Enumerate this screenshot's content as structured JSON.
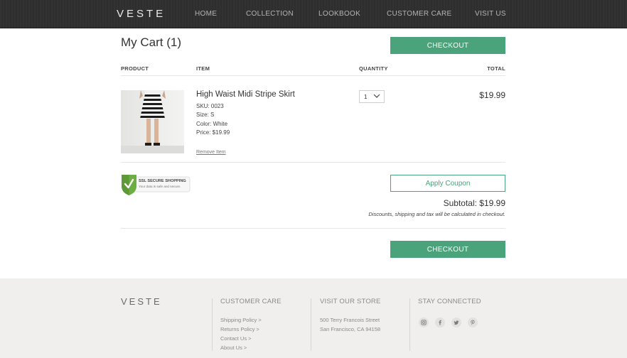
{
  "header": {
    "logo": "VESTE",
    "nav": [
      "HOME",
      "COLLECTION",
      "LOOKBOOK",
      "CUSTOMER CARE",
      "VISIT US"
    ]
  },
  "cart": {
    "title": "My Cart (1)",
    "checkout_label": "CHECKOUT",
    "columns": {
      "product": "PRODUCT",
      "item": "ITEM",
      "quantity": "QUANTITY",
      "total": "TOTAL"
    },
    "item": {
      "name": "High Waist Midi Stripe Skirt",
      "sku": "SKU: 0023",
      "size": "Size: S",
      "color": "Color: White",
      "price": "Price: $19.99",
      "remove_label": "Remove Item",
      "quantity": "1",
      "total": "$19.99"
    },
    "ssl_badge": {
      "title": "SSL SECURE SHOPPING",
      "subtitle": "Your data is safe and secure."
    },
    "coupon_label": "Apply Coupon",
    "subtotal": "Subtotal: $19.99",
    "subtotal_note": "Discounts, shipping and tax will be calculated in checkout."
  },
  "footer": {
    "logo": "VESTE",
    "customer_care": {
      "heading": "CUSTOMER CARE",
      "links": [
        "Shipping Policy >",
        "Returns Policy >",
        "Contact Us >",
        "About Us >"
      ]
    },
    "store": {
      "heading": "VISIT OUR STORE",
      "address_line1": "500 Terry Francois Street",
      "address_line2": "San Francisco, CA 94158"
    },
    "social": {
      "heading": "STAY CONNECTED",
      "icons": [
        "instagram-icon",
        "facebook-icon",
        "twitter-icon",
        "pinterest-icon"
      ]
    }
  },
  "colors": {
    "accent": "#4aa37a",
    "header_bg": "#2f2f2f",
    "footer_bg": "#f0efed"
  }
}
